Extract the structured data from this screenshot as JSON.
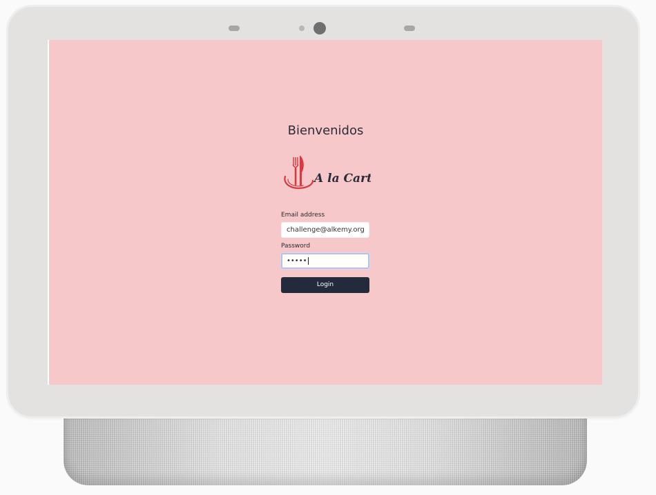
{
  "welcome_title": "Bienvenidos",
  "logo": {
    "name": "A la Carta",
    "icon": "fork-knife-plate-icon",
    "brand_color": "#d9383f",
    "text_color": "#2a2c3a"
  },
  "form": {
    "email_label": "Email address",
    "email_value": "challenge@alkemy.org",
    "password_label": "Password",
    "password_value": "•••••",
    "login_label": "Login"
  },
  "colors": {
    "screen_background": "#f7c8ca",
    "button_background": "#232a3c",
    "device_frame": "#e3e2e1"
  }
}
